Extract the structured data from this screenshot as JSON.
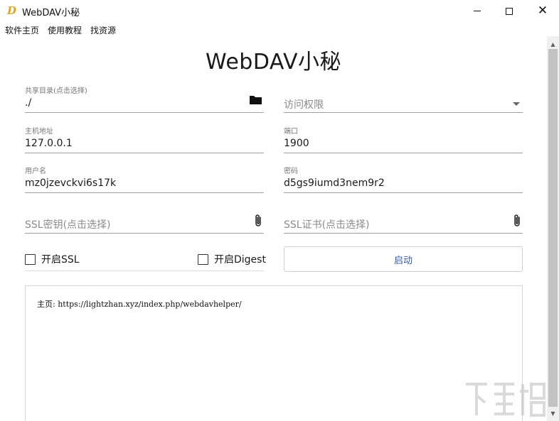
{
  "window": {
    "icon_letter": "D",
    "title": "WebDAV小秘",
    "close_glyph": "✕"
  },
  "menu": {
    "items": [
      "软件主页",
      "使用教程",
      "找资源"
    ]
  },
  "header": {
    "title": "WebDAV小秘"
  },
  "form": {
    "shared_dir": {
      "label": "共享目录(点击选择)",
      "value": "./"
    },
    "access": {
      "placeholder": "访问权限"
    },
    "host": {
      "label": "主机地址",
      "value": "127.0.0.1"
    },
    "port": {
      "label": "端口",
      "value": "1900"
    },
    "username": {
      "label": "用户名",
      "value": "mz0jzevckvi6s17k"
    },
    "password": {
      "label": "密码",
      "value": "d5gs9iumd3nem9r2"
    },
    "ssl_key": {
      "placeholder": "SSL密钥(点击选择)"
    },
    "ssl_cert": {
      "placeholder": "SSL证书(点击选择)"
    },
    "enable_ssl": {
      "label": "开启SSL",
      "checked": false
    },
    "enable_digest": {
      "label": "开启Digest",
      "checked": false
    },
    "start_button": "启动"
  },
  "log": {
    "text": "主页: https://lightzhan.xyz/index.php/webdavhelper/"
  },
  "colors": {
    "accent": "#3a57a8",
    "icon_orange": "#e2a521"
  },
  "icons": {
    "folder": "folder-icon",
    "attach": "paperclip-icon",
    "dropdown": "chevron-down-icon"
  }
}
